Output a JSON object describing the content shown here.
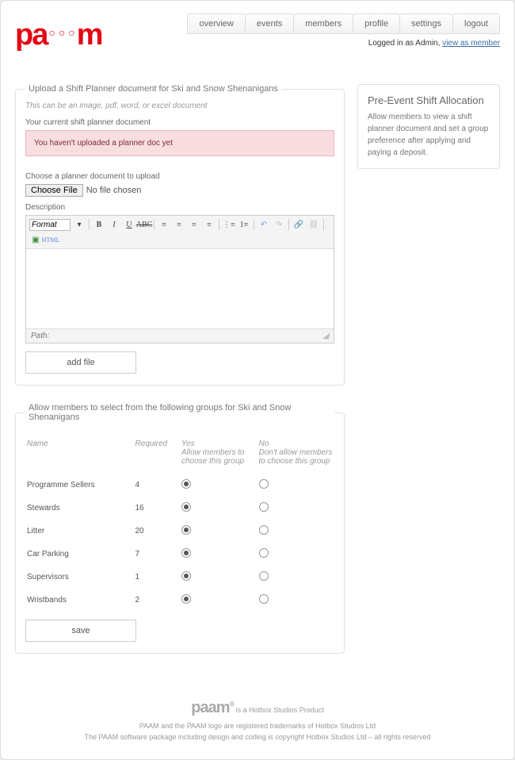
{
  "nav": [
    "overview",
    "events",
    "members",
    "profile",
    "settings",
    "logout"
  ],
  "login": {
    "prefix": "Logged in as Admin, ",
    "link": "view as member"
  },
  "upload": {
    "legend": "Upload a Shift Planner document for Ski and Snow Shenanigans",
    "subtitle": "This can be an image, pdf, word, or excel document",
    "current_label": "Your current shift planner document",
    "alert": "You haven't uploaded a planner doc yet",
    "choose_label": "Choose a planner document to upload",
    "choose_btn": "Choose File",
    "no_file": "No file chosen",
    "desc_label": "Description",
    "format": "Format",
    "path": "Path:",
    "add_btn": "add file"
  },
  "groups": {
    "legend": "Allow members to select from the following groups for Ski and Snow Shenanigans",
    "headers": {
      "name": "Name",
      "required": "Required",
      "yes": "Yes",
      "yes_sub": "Allow members to choose this group",
      "no": "No",
      "no_sub": "Don't allow members to choose this group"
    },
    "rows": [
      {
        "name": "Programme Sellers",
        "required": 4,
        "allow": true
      },
      {
        "name": "Stewards",
        "required": 16,
        "allow": true
      },
      {
        "name": "Litter",
        "required": 20,
        "allow": true
      },
      {
        "name": "Car Parking",
        "required": 7,
        "allow": true
      },
      {
        "name": "Supervisors",
        "required": 1,
        "allow": true
      },
      {
        "name": "Wristbands",
        "required": 2,
        "allow": true
      }
    ],
    "save_btn": "save"
  },
  "sidebar": {
    "title": "Pre-Event Shift Allocation",
    "text": "Allow members to view a shift planner document and set a group preference after applying and paying a deposit."
  },
  "footer": {
    "tag": " is a Hotbox Studios Product",
    "line2": "PAAM and the PAAM logo are registered trademarks of Hotbox Studios Ltd",
    "line3": "The PAAM software package including design and coding is copyright Hotbox Studios Ltd – all rights reserved"
  }
}
